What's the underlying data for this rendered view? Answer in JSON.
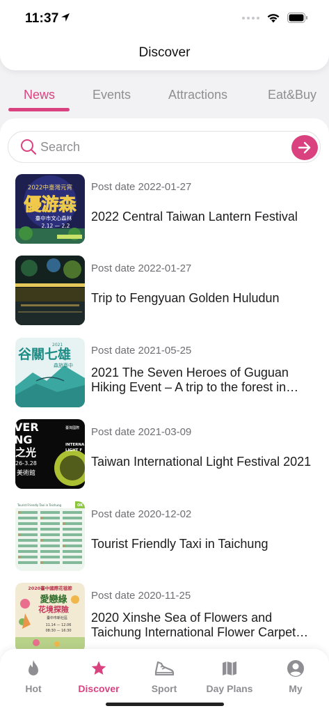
{
  "status_bar": {
    "time": "11:37"
  },
  "header": {
    "title": "Discover"
  },
  "tabs": [
    {
      "label": "News",
      "active": true
    },
    {
      "label": "Events",
      "active": false
    },
    {
      "label": "Attractions",
      "active": false
    },
    {
      "label": "Eat&Buy",
      "active": false
    }
  ],
  "search": {
    "placeholder": "Search",
    "value": ""
  },
  "news": [
    {
      "date": "Post date 2022-01-27",
      "title": "2022 Central Taiwan Lantern Festival"
    },
    {
      "date": "Post date 2022-01-27",
      "title": "Trip to Fengyuan  Golden Huludun"
    },
    {
      "date": "Post date 2021-05-25",
      "title": "2021 The Seven Heroes of Guguan Hiking Event – A trip to the forest in Taichung"
    },
    {
      "date": "Post date 2021-03-09",
      "title": "Taiwan International Light Festival 2021"
    },
    {
      "date": "Post date 2020-12-02",
      "title": "Tourist Friendly Taxi in Taichung"
    },
    {
      "date": "Post date 2020-11-25",
      "title": "2020 Xinshe Sea of Flowers and Taichung International Flower Carpet Festival"
    }
  ],
  "thumbnails": {
    "thumb1": {
      "year": "2022中臺灣元宵",
      "calligraphy": "優游森",
      "subtitle": "臺中市文心森林",
      "dates": "2.12 — 2.2"
    },
    "thumb3": {
      "year": "2021",
      "calligraphy": "谷關七雄",
      "subtitle": "森旅臺中"
    },
    "thumb4": {
      "l1": "VER",
      "l2": "NG",
      "l3": "之光",
      "l4": "26-3.28",
      "l5": "美術館",
      "r1": "臺灣國際",
      "r2": "INTERNA",
      "r3": "LIGHT F"
    },
    "thumb5": {
      "title": "Tourist Friendly Taxi in Taichung",
      "badge": "OK"
    },
    "thumb6": {
      "year": "2020臺中國際花毯節",
      "t1": "愛戀綠",
      "t2": "花境探險",
      "line": "臺中市新社區",
      "dates": "11.14 — 12.06",
      "time": "08:30 — 16:30"
    }
  },
  "bottom_nav": [
    {
      "label": "Hot",
      "icon": "flame-icon",
      "active": false
    },
    {
      "label": "Discover",
      "icon": "star-icon",
      "active": true
    },
    {
      "label": "Sport",
      "icon": "sneaker-icon",
      "active": false
    },
    {
      "label": "Day Plans",
      "icon": "map-icon",
      "active": false
    },
    {
      "label": "My",
      "icon": "account-icon",
      "active": false
    }
  ],
  "colors": {
    "accent": "#d9427f",
    "inactive": "#8e8e93",
    "background": "#f2f2f4"
  }
}
